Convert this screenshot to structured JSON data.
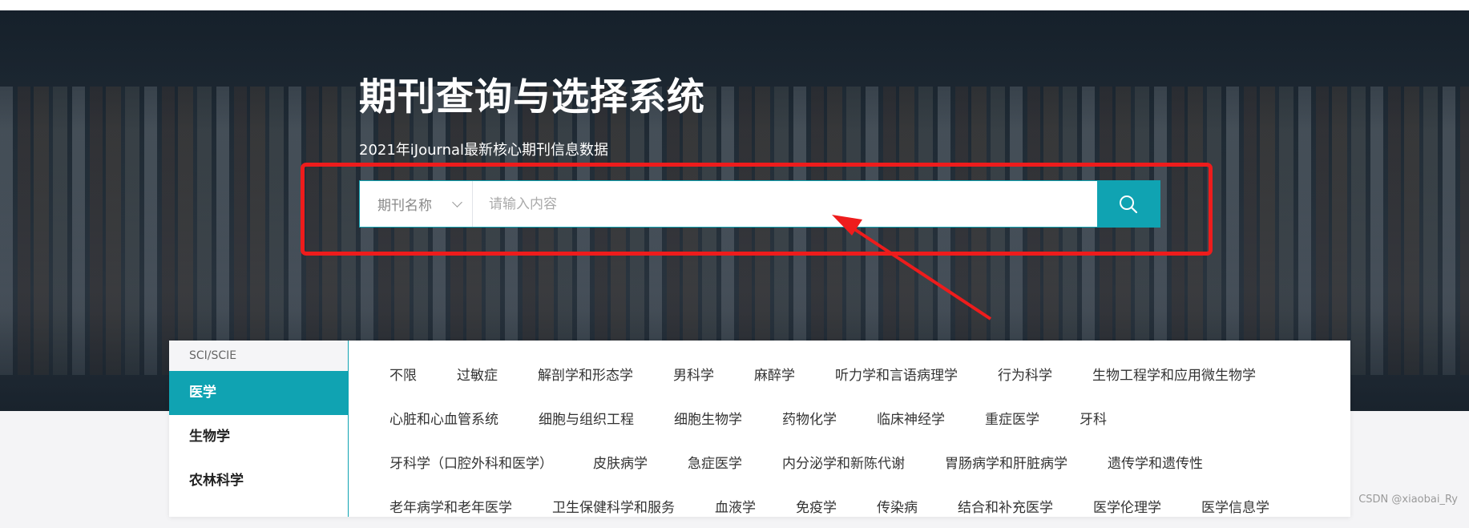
{
  "hero": {
    "title": "期刊查询与选择系统",
    "subtitle": "2021年iJournal最新核心期刊信息数据"
  },
  "search": {
    "type_label": "期刊名称",
    "placeholder": "请输入内容",
    "value": "",
    "button_icon": "search-icon"
  },
  "categories": {
    "header": "SCI/SCIE",
    "items": [
      {
        "label": "医学",
        "active": true
      },
      {
        "label": "生物学",
        "active": false
      },
      {
        "label": "农林科学",
        "active": false
      }
    ]
  },
  "subjects": {
    "rows": [
      [
        "不限",
        "过敏症",
        "解剖学和形态学",
        "男科学",
        "麻醉学",
        "听力学和言语病理学",
        "行为科学",
        "生物工程学和应用微生物学"
      ],
      [
        "心脏和心血管系统",
        "细胞与组织工程",
        "细胞生物学",
        "药物化学",
        "临床神经学",
        "重症医学",
        "牙科"
      ],
      [
        "牙科学（口腔外科和医学）",
        "皮肤病学",
        "急症医学",
        "内分泌学和新陈代谢",
        "胃肠病学和肝脏病学",
        "遗传学和遗传性"
      ],
      [
        "老年病学和老年医学",
        "卫生保健科学和服务",
        "血液学",
        "免疫学",
        "传染病",
        "结合和补充医学",
        "医学伦理学",
        "医学信息学"
      ]
    ]
  },
  "watermark": "CSDN @xiaobai_Ry",
  "colors": {
    "accent": "#10a3b2",
    "annotation": "#ee1c1c"
  }
}
